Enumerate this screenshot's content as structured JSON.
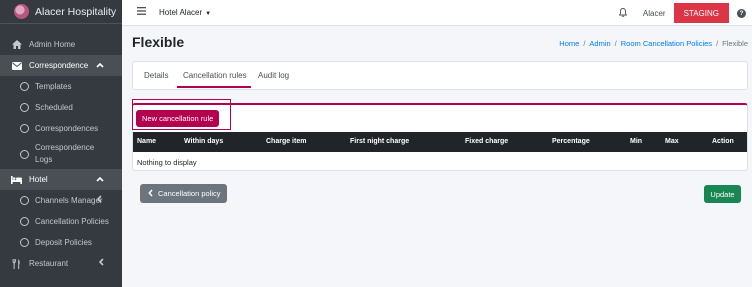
{
  "brand": {
    "name": "Alacer Hospitality"
  },
  "sidebar": {
    "items": [
      {
        "label": "Admin Home",
        "icon": "home-icon"
      },
      {
        "label": "Correspondence",
        "icon": "envelope-icon",
        "expanded": true
      },
      {
        "label": "Templates",
        "icon": "circle-icon"
      },
      {
        "label": "Scheduled",
        "icon": "circle-icon"
      },
      {
        "label": "Correspondences",
        "icon": "circle-icon"
      },
      {
        "label": "Correspondence Logs",
        "icon": "circle-icon"
      },
      {
        "label": "Hotel",
        "icon": "bed-icon",
        "expanded": true
      },
      {
        "label": "Channels Manager",
        "icon": "circle-icon"
      },
      {
        "label": "Cancellation Policies",
        "icon": "circle-icon"
      },
      {
        "label": "Deposit Policies",
        "icon": "circle-icon"
      },
      {
        "label": "Restaurant",
        "icon": "utensils-icon",
        "expanded": false
      }
    ]
  },
  "topbar": {
    "hotel_selector": "Hotel Alacer",
    "user": "Alacer",
    "environment_badge": "STAGING"
  },
  "page": {
    "title": "Flexible",
    "breadcrumb": [
      "Home",
      "Admin",
      "Room Cancellation Policies",
      "Flexible"
    ]
  },
  "tabs": [
    {
      "label": "Details",
      "active": false
    },
    {
      "label": "Cancellation rules",
      "active": true
    },
    {
      "label": "Audit log",
      "active": false
    }
  ],
  "rules": {
    "new_button": "New cancellation rule",
    "columns": [
      "Name",
      "Within days",
      "Charge item",
      "First night charge",
      "Fixed charge",
      "Percentage",
      "Min",
      "Max",
      "Action"
    ],
    "empty_text": "Nothing to display"
  },
  "footer": {
    "back_button": "Cancellation policy",
    "update_button": "Update"
  },
  "colors": {
    "accent": "#b3004f",
    "sidebar": "#343a40",
    "staging": "#dc3545",
    "update": "#198754",
    "back": "#6c757d"
  }
}
